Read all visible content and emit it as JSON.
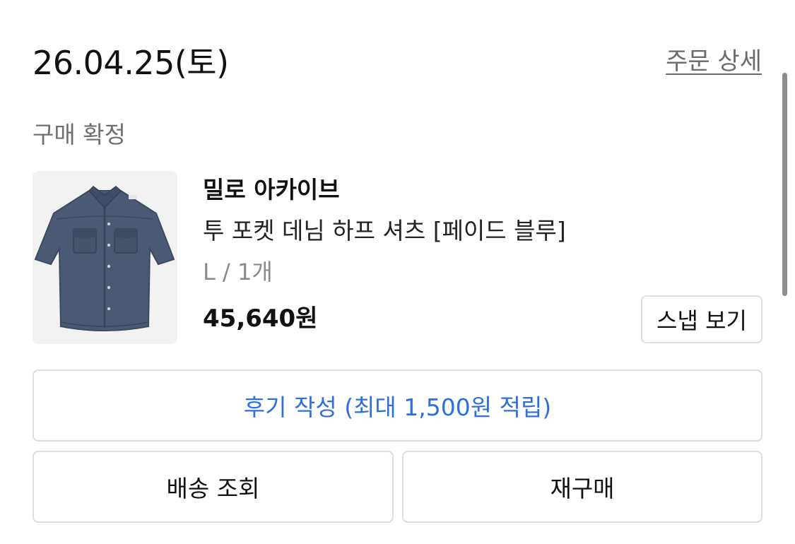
{
  "order": {
    "date": "26.04.25(토)",
    "detail_link": "주문 상세",
    "status": "구매 확정"
  },
  "product": {
    "brand": "밀로 아카이브",
    "name": "투 포켓 데님 하프 셔츠 [페이드 블루]",
    "option": "L / 1개",
    "price": "45,640원",
    "image_icon": "denim-shirt-image"
  },
  "buttons": {
    "snap": "스냅 보기",
    "review": "후기 작성 (최대 1,500원 적립)",
    "track": "배송 조회",
    "reorder": "재구매"
  },
  "colors": {
    "accent": "#2f6fdc",
    "border": "#dedede",
    "muted": "#8a8a8a"
  }
}
